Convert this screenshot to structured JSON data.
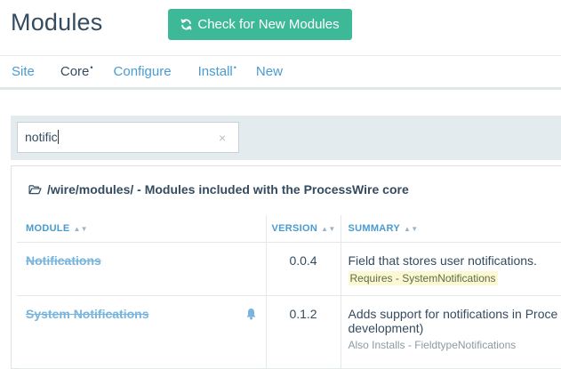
{
  "header": {
    "title": "Modules",
    "check_button_label": "Check for New Modules"
  },
  "tabs": [
    {
      "label": "Site",
      "active": false,
      "dot": ""
    },
    {
      "label": "Core",
      "active": true,
      "dot": "•"
    },
    {
      "label": "Configure",
      "active": false,
      "dot": ""
    },
    {
      "label": "Install",
      "active": false,
      "dot": "•"
    },
    {
      "label": "New",
      "active": false,
      "dot": ""
    }
  ],
  "filter": {
    "value": "notific",
    "clear_icon": "×"
  },
  "panel": {
    "heading": "/wire/modules/ - Modules included with the ProcessWire core",
    "columns": {
      "module": "MODULE",
      "version": "VERSION",
      "summary": "SUMMARY"
    },
    "rows": [
      {
        "name": "Notifications",
        "version": "0.0.4",
        "summary": "Field that stores user notifications.",
        "note": "Requires - SystemNotifications"
      },
      {
        "name": "System Notifications",
        "version": "0.1.2",
        "summary": "Adds support for notifications in Proce",
        "summary_line2": "development)",
        "note": "Also Installs - FieldtypeNotifications"
      }
    ]
  },
  "colors": {
    "accent": "#3eb998",
    "link": "#4a9bd0",
    "text": "#354b60",
    "highlight": "#fbf8d3"
  },
  "icons": {
    "refresh": "refresh-icon",
    "folder": "folder-open-icon",
    "bell": "bell-icon",
    "sort": "sort-icon"
  }
}
